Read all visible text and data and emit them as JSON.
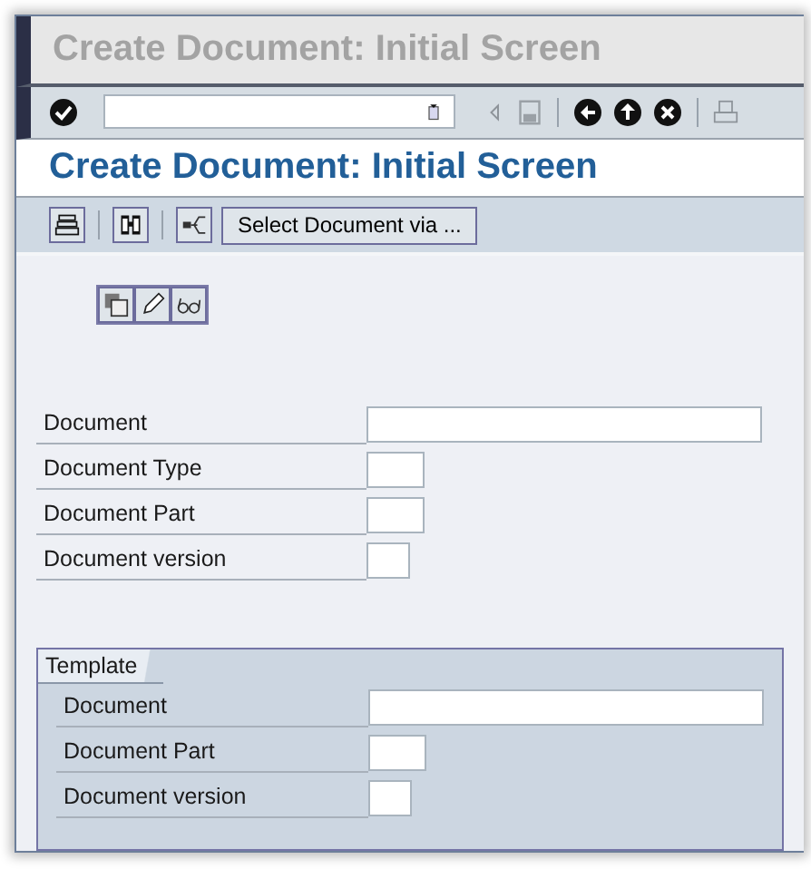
{
  "window": {
    "title": "Create Document: Initial Screen"
  },
  "screen_title": "Create Document: Initial Screen",
  "app_toolbar": {
    "select_button": "Select Document via ..."
  },
  "fields": [
    {
      "label": "Document",
      "kind": "long"
    },
    {
      "label": "Document Type",
      "kind": "short"
    },
    {
      "label": "Document Part",
      "kind": "short"
    },
    {
      "label": "Document version",
      "kind": "tiny"
    }
  ],
  "template": {
    "title": "Template",
    "fields": [
      {
        "label": "Document",
        "kind": "long"
      },
      {
        "label": "Document Part",
        "kind": "short"
      },
      {
        "label": "Document version",
        "kind": "tiny"
      }
    ]
  }
}
